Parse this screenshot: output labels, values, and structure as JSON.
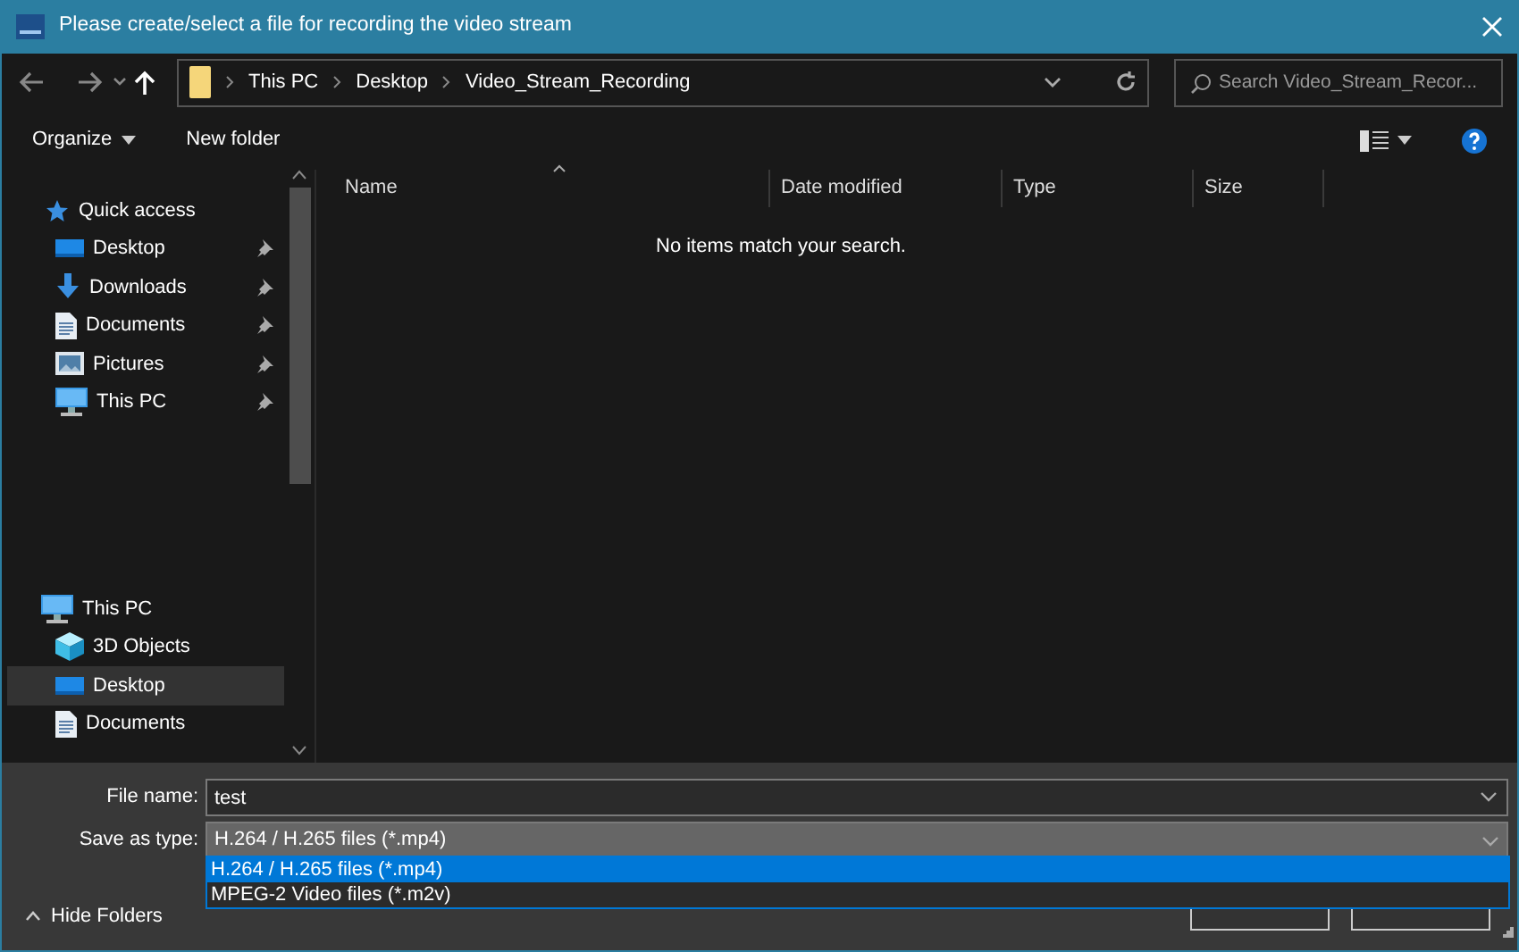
{
  "window": {
    "title": "Please create/select a file for recording the video stream"
  },
  "breadcrumbs": [
    "This PC",
    "Desktop",
    "Video_Stream_Recording"
  ],
  "search": {
    "placeholder": "Search Video_Stream_Recor..."
  },
  "toolbar": [
    {
      "label": "Organize",
      "has_menu": true
    },
    {
      "label": "New folder",
      "has_menu": false
    }
  ],
  "sidebar": {
    "groups": [
      {
        "label": "Quick access",
        "kind": "star",
        "items": [
          {
            "label": "Desktop",
            "kind": "desktop",
            "pinned": true,
            "selected": false
          },
          {
            "label": "Downloads",
            "kind": "download",
            "pinned": true,
            "selected": false
          },
          {
            "label": "Documents",
            "kind": "document",
            "pinned": true,
            "selected": false
          },
          {
            "label": "Pictures",
            "kind": "picture",
            "pinned": true,
            "selected": false
          },
          {
            "label": "This PC",
            "kind": "pc",
            "pinned": true,
            "selected": false
          }
        ]
      },
      {
        "label": "This PC",
        "kind": "pc",
        "items": [
          {
            "label": "3D Objects",
            "kind": "cube",
            "pinned": false,
            "selected": false
          },
          {
            "label": "Desktop",
            "kind": "desktop",
            "pinned": false,
            "selected": true
          },
          {
            "label": "Documents",
            "kind": "document",
            "pinned": false,
            "selected": false
          }
        ]
      }
    ]
  },
  "columns": [
    {
      "label": "Name",
      "sorted": true
    },
    {
      "label": "Date modified",
      "sorted": false
    },
    {
      "label": "Type",
      "sorted": false
    },
    {
      "label": "Size",
      "sorted": false
    }
  ],
  "empty_message": "No items match your search.",
  "file_name": {
    "label": "File name:",
    "value": "test"
  },
  "save_as_type": {
    "label": "Save as type:",
    "value": "H.264 / H.265 files (*.mp4)",
    "expanded": true,
    "options": [
      {
        "label": "H.264 / H.265 files (*.mp4)",
        "selected": true
      },
      {
        "label": "MPEG-2 Video files (*.m2v)",
        "selected": false
      }
    ]
  },
  "hide_folders": "Hide Folders",
  "buttons": [
    {
      "kind": "covered"
    },
    {
      "kind": "covered"
    }
  ]
}
